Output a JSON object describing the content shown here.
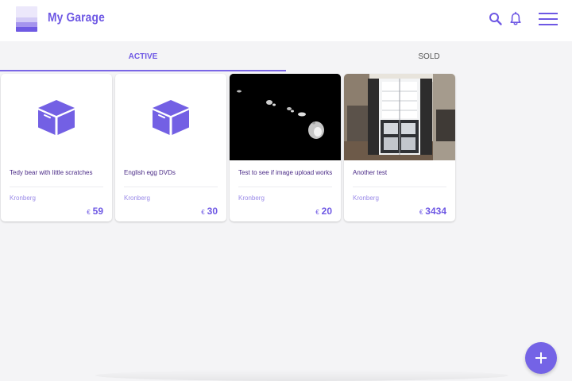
{
  "app": {
    "title": "My Garage",
    "brand_color": "#6e58e4"
  },
  "header_icons": [
    "search-icon",
    "bell-icon",
    "hamburger-menu-icon"
  ],
  "tabs": [
    {
      "label": "ACTIVE",
      "selected": true
    },
    {
      "label": "SOLD",
      "selected": false
    }
  ],
  "currency_symbol": "€",
  "listings": [
    {
      "title": "Tedy bear with little scratches",
      "location": "Kronberg",
      "price": "59",
      "image": "box-placeholder-icon"
    },
    {
      "title": "English egg DVDs",
      "location": "Kronberg",
      "price": "30",
      "image": "box-placeholder-icon"
    },
    {
      "title": "Test to see if image upload works",
      "location": "Kronberg",
      "price": "20",
      "image": "photo-dark-islands"
    },
    {
      "title": "Another test",
      "location": "Kronberg",
      "price": "3434",
      "image": "photo-refrigerator-open"
    }
  ],
  "fab": {
    "icon": "plus-icon"
  }
}
